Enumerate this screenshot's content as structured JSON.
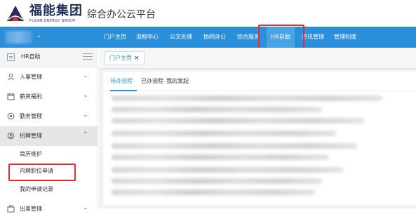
{
  "header": {
    "brand_cn": "福能集团",
    "brand_en": "FUJIAN ENERGY GROUP",
    "platform": "综合办公云平台",
    "logo_color": "#1f2f55",
    "logo_accent": "#e52d2d"
  },
  "nav": {
    "user_caret": "⌄",
    "items": [
      {
        "label": "门户主页"
      },
      {
        "label": "流程中心"
      },
      {
        "label": "公文处理"
      },
      {
        "label": "协同办公"
      },
      {
        "label": "综合服务"
      },
      {
        "label": "HR自助"
      },
      {
        "label": "资讯管理"
      },
      {
        "label": "管理制度"
      }
    ],
    "active": "HR自助",
    "bg_color": "#2b90d9"
  },
  "sidebar": {
    "header_label": "HR自助",
    "items": [
      {
        "label": "人事管理",
        "icon": "person-icon",
        "chevron": "⌄"
      },
      {
        "label": "薪资福利",
        "icon": "calendar-icon",
        "chevron": "⌄"
      },
      {
        "label": "勤务管理",
        "icon": "clock-icon",
        "chevron": "⌄"
      },
      {
        "label": "招聘管理",
        "icon": "recruit-icon",
        "chevron": "⌃"
      }
    ],
    "sub_items": [
      {
        "label": "简历维护"
      },
      {
        "label": "内聘职位申请"
      },
      {
        "label": "我的申请记录"
      }
    ],
    "next_item": {
      "label": "出差管理",
      "chevron": "⌄"
    }
  },
  "content": {
    "tab": {
      "label": "门户主页",
      "close": "×"
    },
    "subtabs": [
      {
        "label": "待办流程"
      },
      {
        "label": "已办流程"
      },
      {
        "label": "我的发起"
      }
    ]
  },
  "colors": {
    "accent": "#2b90d9",
    "highlight": "#e52d2d"
  }
}
